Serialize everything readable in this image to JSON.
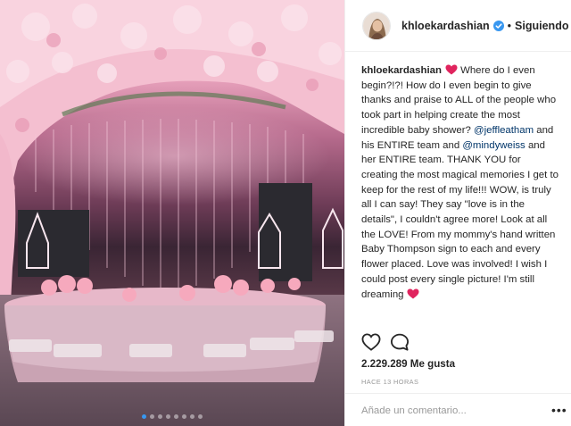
{
  "post": {
    "username": "khloekardashian",
    "separator": "•",
    "follow_label": "Siguiendo",
    "caption": {
      "part1": "Where do I even begin?!?! How do I even begin to give thanks and praise to ALL of the people who took part in helping create the most incredible baby shower?",
      "mention1": "@jeffleatham",
      "part2": "and his ENTIRE team and",
      "mention2": "@mindyweiss",
      "part3": "and her ENTIRE team. THANK YOU for creating the most magical memories I get to keep for the rest of my life!!! WOW, is truly all I can say! They say \"love is in the details\", I couldn't agree more! Look at all the LOVE! From my mommy's hand written Baby Thompson sign to each and every flower placed. Love was involved! I wish I could post every single picture! I'm still dreaming"
    },
    "likes": "2.229.289 Me gusta",
    "timestamp": "HACE 13 HORAS",
    "comment_placeholder": "Añade un comentario...",
    "more_label": "•••",
    "carousel": {
      "count": 8,
      "active_index": 0
    }
  },
  "colors": {
    "verified_blue": "#3897f0",
    "heart_red": "#e0245e",
    "mention_blue": "#003569",
    "muted_gray": "#999999"
  },
  "icons": {
    "like": "heart-outline-icon",
    "comment": "speech-bubble-icon",
    "verified": "verified-badge-icon",
    "caption_emoji": "red-heart-icon",
    "more": "more-options-icon"
  }
}
